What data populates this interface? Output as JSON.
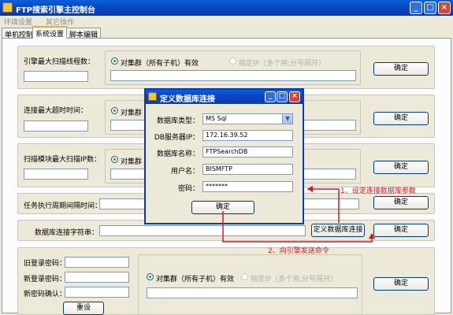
{
  "window": {
    "title": "FTP搜索引擎主控制台"
  },
  "menu": [
    "环境设置",
    "其它操作"
  ],
  "tabs": [
    "单机控制",
    "系统设置",
    "脚本编辑"
  ],
  "groups": {
    "scan_threads": {
      "label": "引擎最大扫描线程数：",
      "radio_all": "对集群（所有子机）有效",
      "radio_ip": "指定IP（多个用;分号隔开）",
      "ok": "确定"
    },
    "timeout": {
      "label": "连接最大超时时间：",
      "radio_all": "对集群（所有子机）有效",
      "ok": "确定"
    },
    "scan_ips": {
      "label": "扫描模块最大扫描IP数：",
      "radio_all": "对集群（所有子机）有效",
      "ok": "确定"
    },
    "interval": {
      "label": "任务执行周期间隔时间：",
      "ok": "确定"
    },
    "connstr": {
      "label": "数据库连接字符串：",
      "define_btn": "定义数据库连接",
      "ok": "确定"
    },
    "password": {
      "old_label": "旧登录密码：",
      "new_label": "新登录密码：",
      "confirm_label": "新密码确认：",
      "reset": "重设",
      "radio_all": "对集群（所有子机）有效",
      "radio_ip": "指定IP（多个用;分号隔开）",
      "ok": "确定"
    }
  },
  "dialog": {
    "title": "定义数据库连接",
    "db_type_label": "数据库类型：",
    "db_type_value": "MS Sql",
    "server_label": "DB服务器IP：",
    "server_value": "172.16.39.52",
    "dbname_label": "数据库名称：",
    "dbname_value": "FTPSearchDB",
    "user_label": "用户名：",
    "user_value": "BISMFTP",
    "pwd_label": "密码：",
    "pwd_value": "*******",
    "ok": "确定"
  },
  "annotations": {
    "step1": "1、设定连接数据库参数",
    "step2": "2、向引擎发送命令"
  }
}
